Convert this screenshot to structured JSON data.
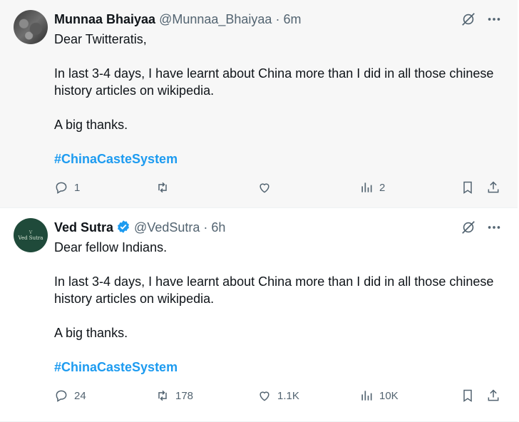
{
  "tweets": [
    {
      "name": "Munnaa Bhaiyaa",
      "handle": "@Munnaa_Bhaiyaa",
      "time_sep": " · ",
      "time": "6m",
      "verified": false,
      "paragraphs": [
        "Dear Twitteratis,",
        "In last 3-4 days, I have learnt about China more than I did in all those chinese history articles on wikipedia.",
        "A big thanks."
      ],
      "hashtag": "#ChinaCasteSystem",
      "replies": "1",
      "retweets": "",
      "likes": "",
      "views": "2"
    },
    {
      "name": "Ved Sutra",
      "handle": "@VedSutra",
      "time_sep": " · ",
      "time": "6h",
      "verified": true,
      "avatar_mark": "V",
      "avatar_text": "Ved Sutra",
      "paragraphs": [
        "Dear fellow Indians.",
        "In last 3-4 days, I have learnt about China more than I did in all those chinese history articles on wikipedia.",
        "A big thanks."
      ],
      "hashtag": "#ChinaCasteSystem",
      "replies": "24",
      "retweets": "178",
      "likes": "1.1K",
      "views": "10K"
    }
  ],
  "icons": {
    "grok": "grok-icon",
    "more": "more-icon",
    "reply": "reply-icon",
    "retweet": "retweet-icon",
    "like": "like-icon",
    "views": "views-icon",
    "bookmark": "bookmark-icon",
    "share": "share-icon"
  },
  "colors": {
    "text": "#0f1419",
    "muted": "#536471",
    "hashtag": "#1d9bf0",
    "verified": "#1d9bf0",
    "highlight_bg": "#f7f7f7"
  }
}
